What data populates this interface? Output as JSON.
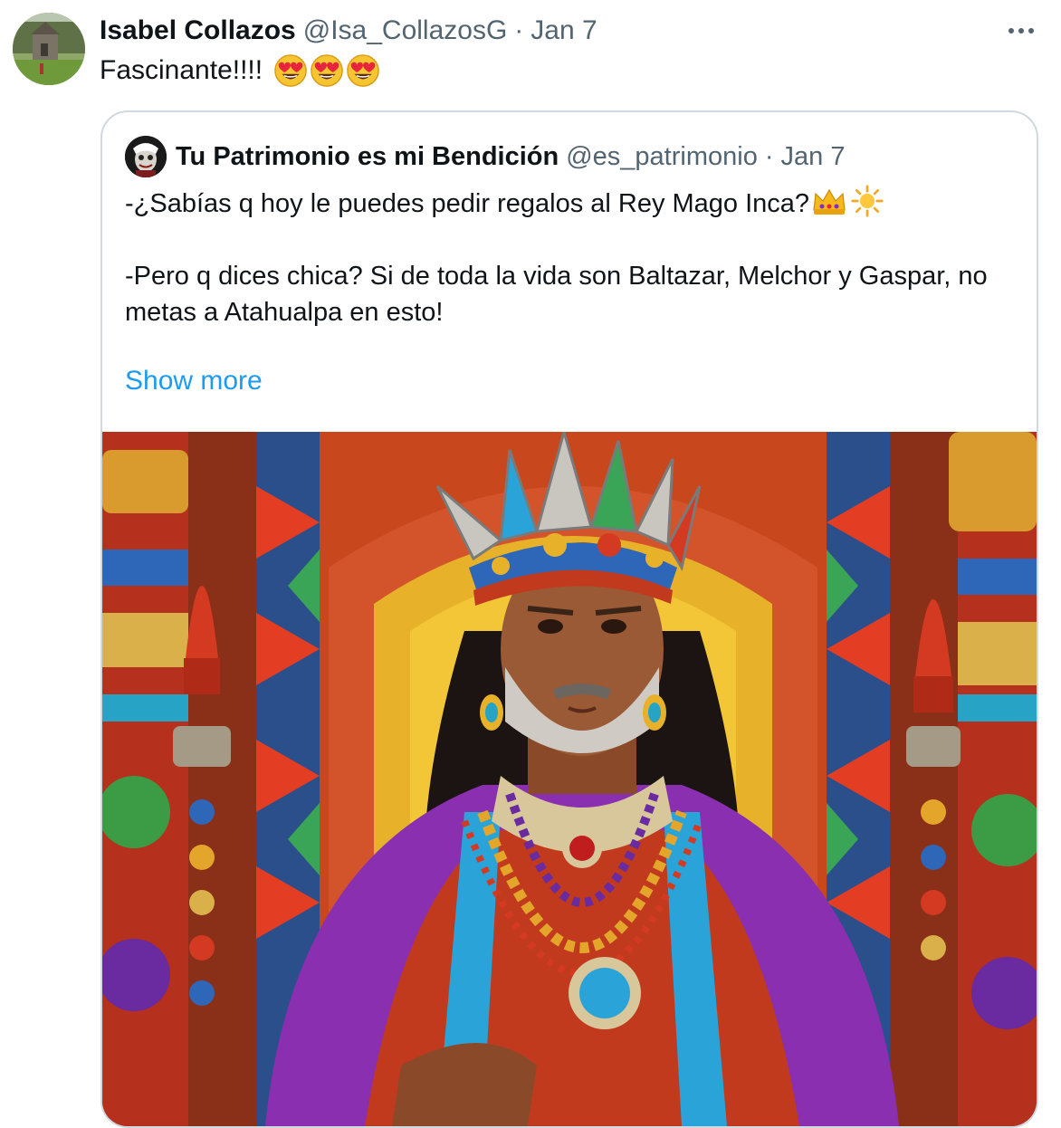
{
  "tweet": {
    "author_name": "Isabel Collazos",
    "author_handle": "@Isa_CollazosG",
    "separator": "·",
    "date": "Jan 7",
    "text": "Fascinante!!!!",
    "emojis": [
      "heart-eyes-emoji",
      "heart-eyes-emoji",
      "heart-eyes-emoji"
    ]
  },
  "quoted": {
    "author_name": "Tu Patrimonio es mi Bendición",
    "author_handle": "@es_patrimonio",
    "separator": "·",
    "date": "Jan 7",
    "line1": "-¿Sabías q hoy le puedes pedir regalos al Rey Mago Inca?",
    "line1_emojis": [
      "crown-emoji",
      "sun-emoji"
    ],
    "line2": "-Pero q dices chica? Si de toda la vida son Baltazar, Melchor y Gaspar, no metas a Atahualpa en esto!",
    "show_more": "Show more",
    "media": "inca-king-illustration"
  },
  "colors": {
    "text": "#0f1419",
    "muted": "#536471",
    "link": "#1d9bf0",
    "border": "#cfd9de"
  }
}
